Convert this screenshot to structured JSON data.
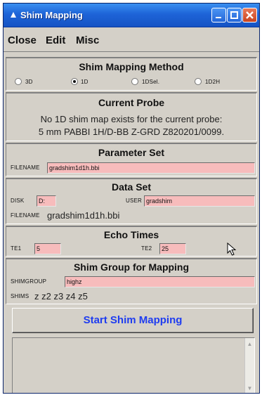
{
  "window": {
    "title": "Shim Mapping"
  },
  "menu": {
    "close": "Close",
    "edit": "Edit",
    "misc": "Misc"
  },
  "method": {
    "title": "Shim Mapping Method",
    "options": [
      "3D",
      "1D",
      "1DSel.",
      "1D2H"
    ],
    "selected": "1D"
  },
  "probe": {
    "title": "Current Probe",
    "line1": "No 1D shim map exists for the current probe:",
    "line2": "5 mm PABBI 1H/D-BB Z-GRD Z820201/0099."
  },
  "parameter_set": {
    "title": "Parameter Set",
    "filename_label": "FILENAME",
    "filename_value": "gradshim1d1h.bbi"
  },
  "data_set": {
    "title": "Data Set",
    "disk_label": "DISK",
    "disk_value": "D:",
    "user_label": "USER",
    "user_value": "gradshim",
    "filename_label": "FILENAME",
    "filename_value": "gradshim1d1h.bbi"
  },
  "echo_times": {
    "title": "Echo Times",
    "te1_label": "TE1",
    "te1_value": "5",
    "te2_label": "TE2",
    "te2_value": "25"
  },
  "shim_group": {
    "title": "Shim Group for Mapping",
    "group_label": "SHIMGROUP",
    "group_value": "highz",
    "shims_label": "SHIMS",
    "shims_value": "z z2 z3 z4 z5"
  },
  "start_button": "Start Shim Mapping",
  "colors": {
    "title_bar": "#1e64d8",
    "field_bg": "#f7bcbc",
    "start_text": "#1e3cf0"
  }
}
